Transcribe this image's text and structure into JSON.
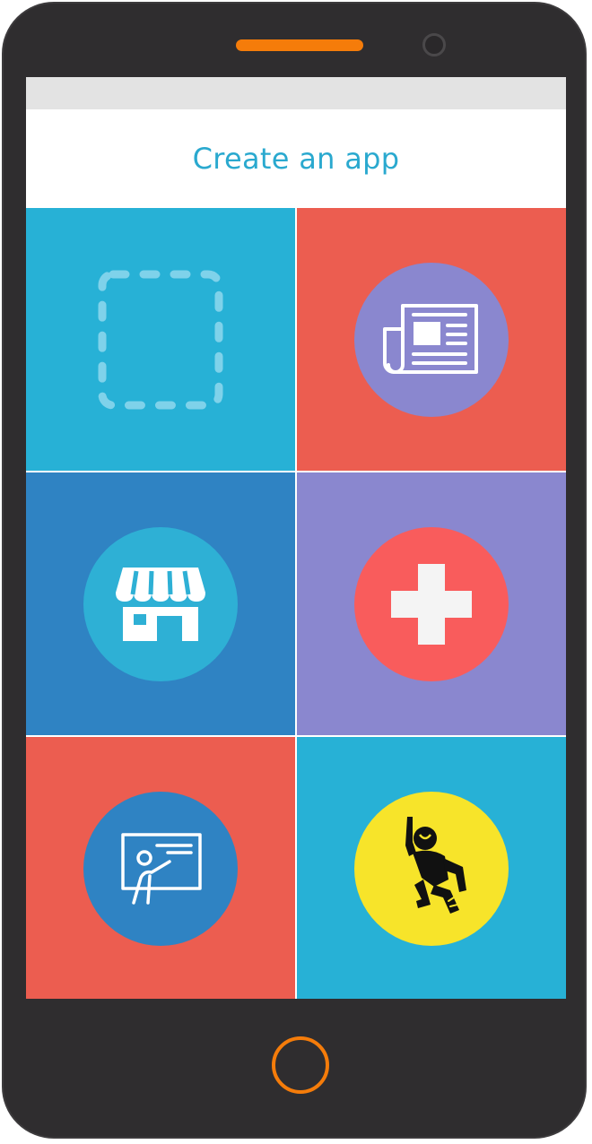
{
  "header": {
    "title": "Create an app"
  },
  "colors": {
    "phone_body": "#2f2d2f",
    "accent_orange": "#f57c0a",
    "title_blue": "#2aa9cf",
    "cyan": "#27b1d6",
    "coral": "#ec5d50",
    "blue": "#2f83c3",
    "purple": "#8a87cf",
    "red": "#f95c5c",
    "yellow": "#f7e42a"
  },
  "tiles": [
    {
      "id": "blank",
      "icon": "dashed-square-icon",
      "background": "#27b1d6"
    },
    {
      "id": "news",
      "icon": "newspaper-icon",
      "background": "#ec5d50",
      "circle": "#8a87cf"
    },
    {
      "id": "store",
      "icon": "storefront-icon",
      "background": "#2f83c3",
      "circle": "#2eb0d5"
    },
    {
      "id": "health",
      "icon": "medical-cross-icon",
      "background": "#8a87cf",
      "circle": "#f95c5c"
    },
    {
      "id": "education",
      "icon": "teacher-board-icon",
      "background": "#ec5d50",
      "circle": "#2f83c3"
    },
    {
      "id": "fun",
      "icon": "dancing-figure-icon",
      "background": "#27b1d6",
      "circle": "#f7e42a"
    }
  ]
}
